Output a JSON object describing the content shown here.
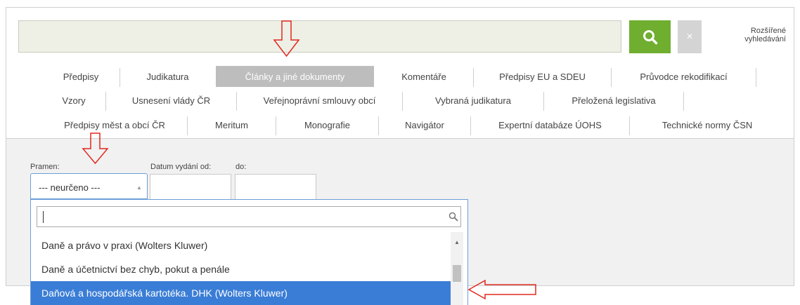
{
  "search": {
    "value": "",
    "advanced_link": "Rozšířené\nvyhledávání",
    "clear_label": "×"
  },
  "tabs": {
    "row1": [
      "Předpisy",
      "Judikatura",
      "Články a jiné dokumenty",
      "Komentáře",
      "Předpisy EU a SDEU",
      "Průvodce rekodifikací"
    ],
    "row2": [
      "Vzory",
      "Usnesení vlády ČR",
      "Veřejnoprávní smlouvy obcí",
      "Vybraná judikatura",
      "Přeložená legislativa"
    ],
    "row3": [
      "Předpisy měst a obcí ČR",
      "Meritum",
      "Monografie",
      "Navigátor",
      "Expertní databáze ÚOHS",
      "Technické normy ČSN"
    ],
    "active": "Články a jiné dokumenty"
  },
  "filters": {
    "source_label": "Pramen:",
    "date_from_label": "Datum vydání od:",
    "date_to_label": "do:",
    "source_value": "--- neurčeno ---",
    "date_from_value": "",
    "date_to_value": ""
  },
  "dropdown": {
    "search_value": "",
    "options": [
      "Daně a právo v praxi (Wolters Kluwer)",
      "Daně a účetnictví bez chyb, pokut a penále",
      "Daňová a hospodářská kartotéka. DHK (Wolters Kluwer)"
    ],
    "highlighted_index": 2
  },
  "colors": {
    "search_button": "#6fae2f",
    "active_tab": "#bdbdbd",
    "highlight": "#3a7dd6",
    "annotation_arrow": "#e0281e"
  }
}
